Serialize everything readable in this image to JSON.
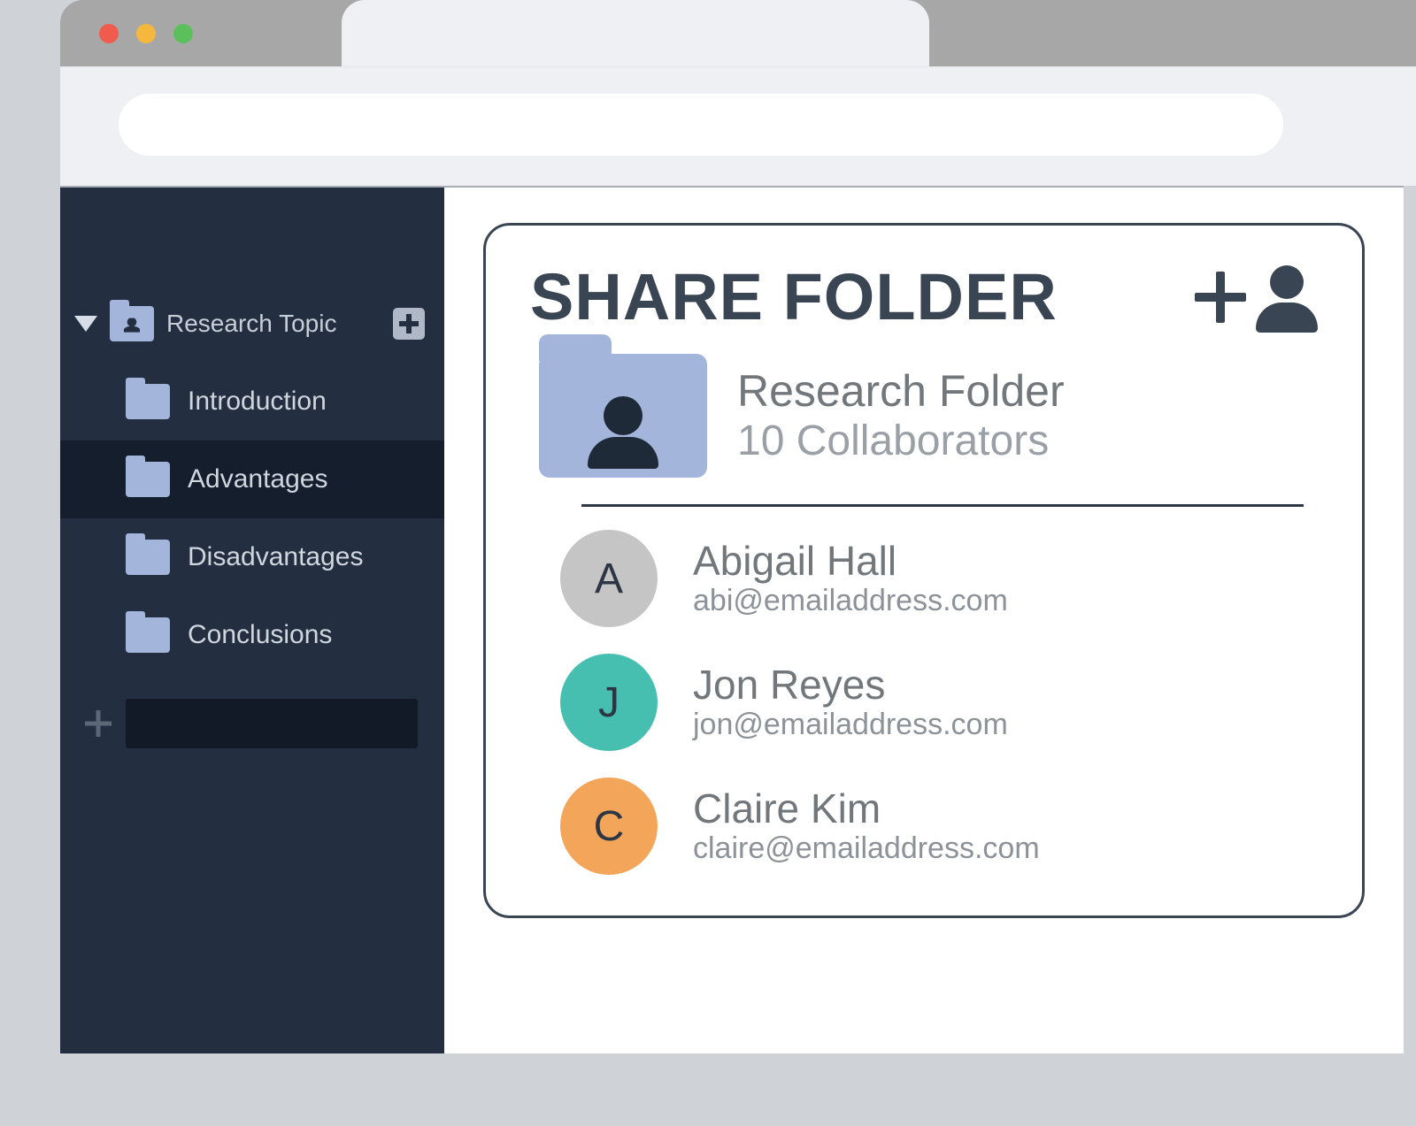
{
  "sidebar": {
    "root_label": "Research Topic",
    "items": [
      {
        "label": "Introduction"
      },
      {
        "label": "Advantages"
      },
      {
        "label": "Disadvantages"
      },
      {
        "label": "Conclusions"
      }
    ],
    "active_index": 1
  },
  "panel": {
    "title": "SHARE FOLDER",
    "folder_name": "Research Folder",
    "collaborator_count": "10 Collaborators"
  },
  "collaborators": [
    {
      "initial": "A",
      "name": "Abigail Hall",
      "email": "abi@emailaddress.com",
      "color": "#c5c5c5"
    },
    {
      "initial": "J",
      "name": "Jon Reyes",
      "email": "jon@emailaddress.com",
      "color": "#46bfb0"
    },
    {
      "initial": "C",
      "name": "Claire Kim",
      "email": "claire@emailaddress.com",
      "color": "#f3a659"
    }
  ]
}
